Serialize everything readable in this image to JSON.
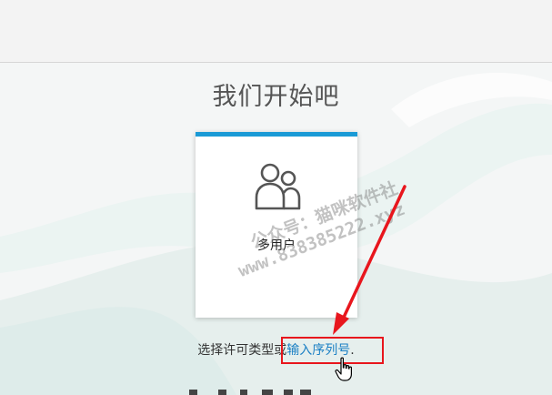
{
  "page": {
    "title": "我们开始吧"
  },
  "license_card": {
    "label": "多用户",
    "icon": "users-icon",
    "accent_color": "#1a9ad6"
  },
  "footer": {
    "prompt_text": "选择许可类型或",
    "link_text": "输入序列号",
    "trailing": "."
  },
  "watermark": {
    "line1": "公众号：猫咪软件社",
    "line2": "www.838385222.xyz"
  },
  "annotation": {
    "color": "#e8161d",
    "arrow_target": "serial-link"
  }
}
